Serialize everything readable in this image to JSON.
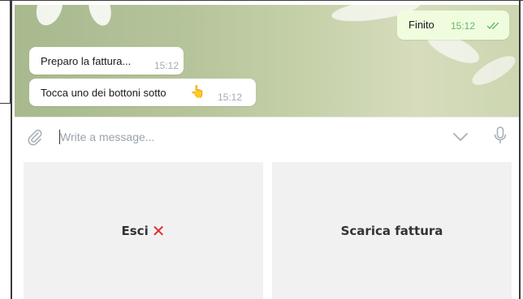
{
  "messages": [
    {
      "text": "Finito",
      "time": "15:12",
      "outgoing": true
    },
    {
      "text": "Preparo la fattura...",
      "time": "15:12",
      "outgoing": false
    },
    {
      "text": "Tocca uno dei bottoni sotto",
      "emoji": "👆",
      "time": "15:12",
      "outgoing": false
    }
  ],
  "composer": {
    "placeholder": "Write a message..."
  },
  "keyboard": {
    "buttons": [
      {
        "label": "Esci",
        "emoji": "✕"
      },
      {
        "label": "Scarica fattura"
      }
    ]
  },
  "colors": {
    "outgoing_bubble": "#effdde",
    "incoming_bubble": "#ffffff",
    "exit_emoji": "#dd2b2b",
    "read_check": "#6cb56c"
  }
}
